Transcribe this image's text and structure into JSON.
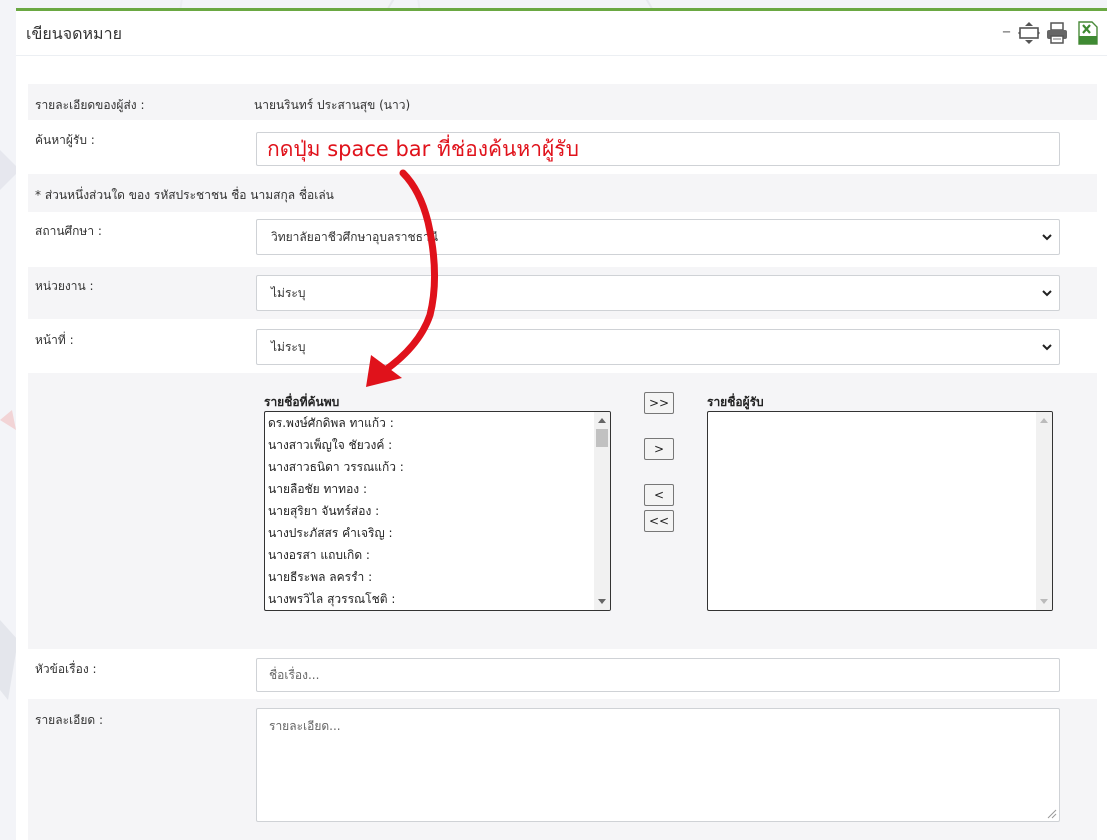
{
  "window": {
    "title": "เขียนจดหมาย",
    "minimize_label": "–",
    "icons": [
      "expand-icon",
      "print-icon",
      "xls-export-icon"
    ]
  },
  "form": {
    "sender_label": "รายละเอียดของผู้ส่ง :",
    "sender_value": "นายนรินทร์ ประสานสุข (นาว)",
    "search_label": "ค้นหาผู้รับ :",
    "search_value": "กดปุ่ม space bar ที่ช่องค้นหาผู้รับ",
    "search_hint": "* ส่วนหนึ่งส่วนใด ของ รหัสประชาชน ชื่อ นามสกุล ชื่อเล่น",
    "institution_label": "สถานศึกษา :",
    "institution_value": "วิทยาลัยอาชีวศึกษาอุบลราชธานี",
    "department_label": "หน่วยงาน :",
    "department_value": "ไม่ระบุ",
    "duty_label": "หน้าที่ :",
    "duty_value": "ไม่ระบุ",
    "subject_label": "หัวข้อเรื่อง :",
    "subject_placeholder": "ชื่อเรื่อง...",
    "detail_label": "รายละเอียด :",
    "detail_placeholder": "รายละเอียด..."
  },
  "found_list": {
    "title": "รายชื่อที่ค้นพบ",
    "items": [
      "ดร.พงษ์ศักดิพล ทาแก้ว :",
      "นางสาวเพ็ญใจ ชัยวงค์ :",
      "นางสาวธนิดา วรรณแก้ว :",
      "นายลือชัย ทาทอง :",
      "นายสุริยา จันทร์ส่อง :",
      "นางประภัสสร คำเจริญ :",
      "นางอรสา แถบเกิด :",
      "นายธีระพล ลครรำ :",
      "นางพรวิไล สุวรรณโชติ :"
    ]
  },
  "recipient_list": {
    "title": "รายชื่อผู้รับ",
    "items": []
  },
  "move_buttons": {
    "add_all": ">>",
    "add_one": ">",
    "remove_one": "<",
    "remove_all": "<<"
  },
  "colors": {
    "header_accent": "#6aa842",
    "annotation_red": "#e0121b"
  }
}
